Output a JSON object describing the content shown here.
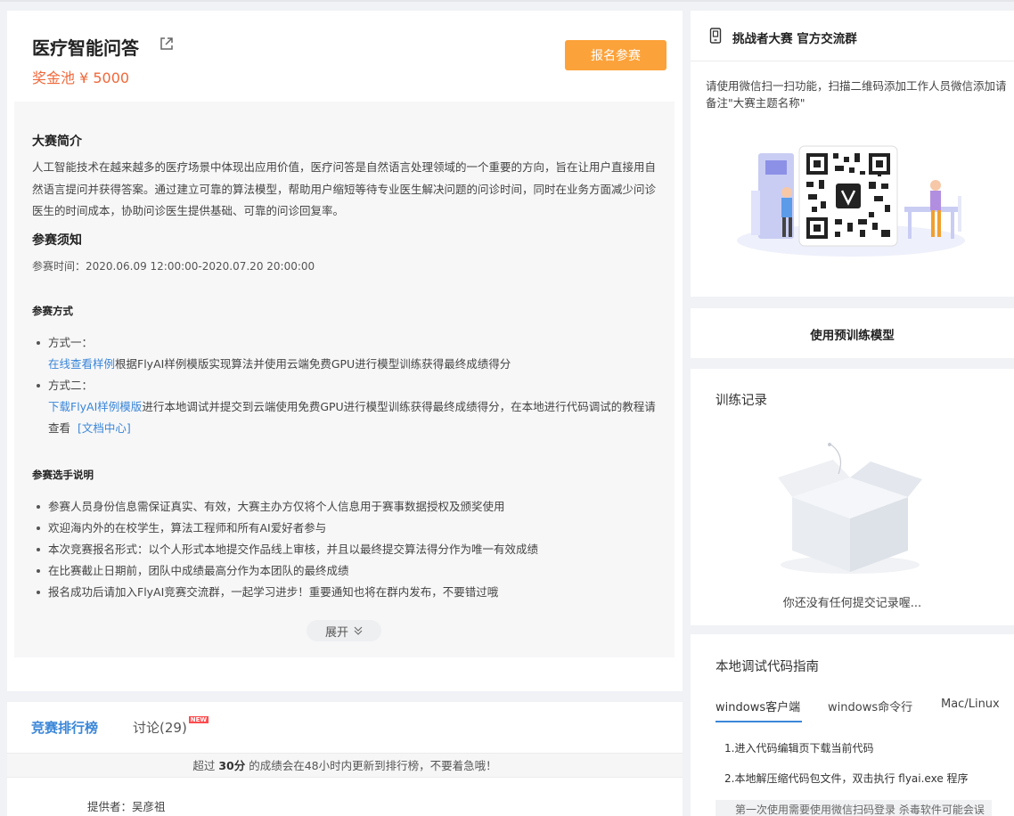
{
  "header": {
    "title": "医疗智能问答",
    "prize": "奖金池 ¥ 5000",
    "signup_button": "报名参赛"
  },
  "intro": {
    "heading": "大赛简介",
    "text": "人工智能技术在越来越多的医疗场景中体现出应用价值，医疗问答是自然语言处理领域的一个重要的方向，旨在让用户直接用自然语言提问并获得答案。通过建立可靠的算法模型，帮助用户缩短等待专业医生解决问题的问诊时间，同时在业务方面减少问诊医生的时间成本，协助问诊医生提供基础、可靠的问诊回复率。"
  },
  "notice": {
    "heading": "参赛须知",
    "time": "参赛时间：2020.06.09 12:00:00-2020.07.20 20:00:00"
  },
  "methods": {
    "heading": "参赛方式",
    "items": [
      {
        "label": "方式一：",
        "link": "在线查看样例",
        "text": "根据FlyAI样例模版实现算法并使用云端免费GPU进行模型训练获得最终成绩得分"
      },
      {
        "label": "方式二：",
        "link": "下载FlyAI样例模版",
        "text": "进行本地调试并提交到云端使用免费GPU进行模型训练获得最终成绩得分，在本地进行代码调试的教程请查看",
        "doc_link": "[文档中心]"
      }
    ]
  },
  "rules": {
    "heading": "参赛选手说明",
    "items": [
      "参赛人员身份信息需保证真实、有效，大赛主办方仅将个人信息用于赛事数据授权及颁奖使用",
      "欢迎海内外的在校学生，算法工程师和所有AI爱好者参与",
      "本次竞赛报名形式：以个人形式本地提交作品线上审核，并且以最终提交算法得分作为唯一有效成绩",
      "在比赛截止日期前，团队中成绩最高分作为本团队的最终成绩",
      "报名成功后请加入FlyAI竞赛交流群，一起学习进步！重要通知也将在群内发布，不要错过哦"
    ]
  },
  "expand_label": "展开",
  "tabs": {
    "leaderboard": "竞赛排行榜",
    "discussion": "讨论(29)",
    "new_badge": "NEW"
  },
  "leaderboard_notice": {
    "prefix": "超过 ",
    "score": "30分",
    "suffix": " 的成绩会在48小时内更新到排行榜，不要着急哦！"
  },
  "provider": "提供者：吴彦祖",
  "qr_panel": {
    "title": "挑战者大赛 官方交流群",
    "text": "请使用微信扫一扫功能，扫描二维码添加工作人员微信添加请备注\"大赛主题名称\""
  },
  "pretrained_label": "使用预训练模型",
  "training": {
    "title": "训练记录",
    "empty_text": "你还没有任何提交记录喔..."
  },
  "guide": {
    "title": "本地调试代码指南",
    "tabs": [
      "windows客户端",
      "windows命令行",
      "Mac/Linux"
    ],
    "steps": [
      "1.进入代码编辑页下载当前代码",
      "2.本地解压缩代码包文件，双击执行 flyai.exe 程序"
    ],
    "note": "第一次使用需要使用微信扫码登录 杀毒软件可能会误"
  },
  "colors": {
    "accent": "#3a86d8",
    "prize": "#f0683a",
    "signup": "#fca23a"
  }
}
